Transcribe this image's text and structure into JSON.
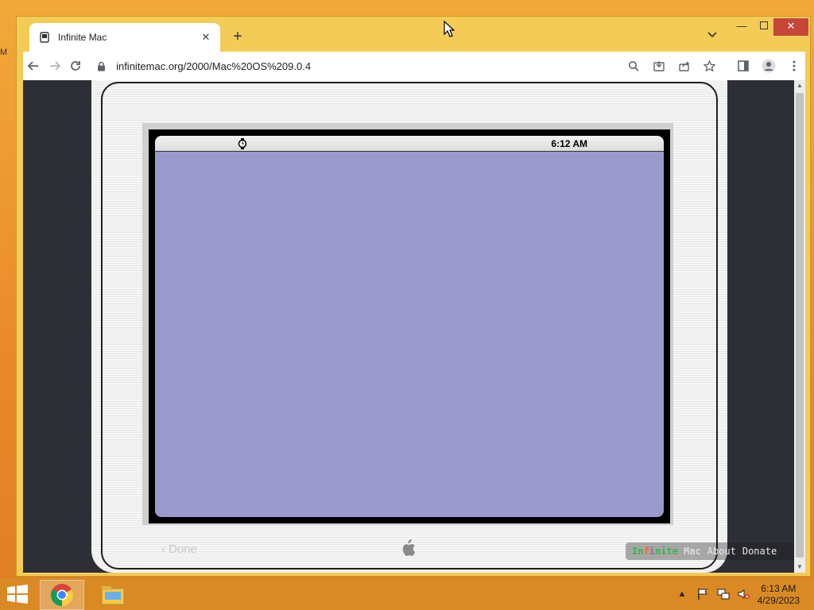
{
  "browser": {
    "tab_title": "Infinite Mac",
    "url": "infinitemac.org/2000/Mac%20OS%209.0.4",
    "new_tab_symbol": "+",
    "tab_close_symbol": "✕"
  },
  "emulator": {
    "menubar_clock": "6:12 AM",
    "screen_color": "#9999cc",
    "done_label": "‹ Done",
    "brand": {
      "part1": "In",
      "part2": "fi",
      "part3": "nite",
      "part4": "Mac"
    },
    "about_label": "About",
    "donate_label": "Donate"
  },
  "taskbar": {
    "time": "6:13 AM",
    "date": "4/29/2023",
    "items": [
      "chrome-icon",
      "file-explorer-icon"
    ]
  },
  "colors": {
    "window_frame": "#f3cc57",
    "taskbar": "#d98a24",
    "close_button": "#c8453a",
    "content_bg": "#2c2f36"
  }
}
